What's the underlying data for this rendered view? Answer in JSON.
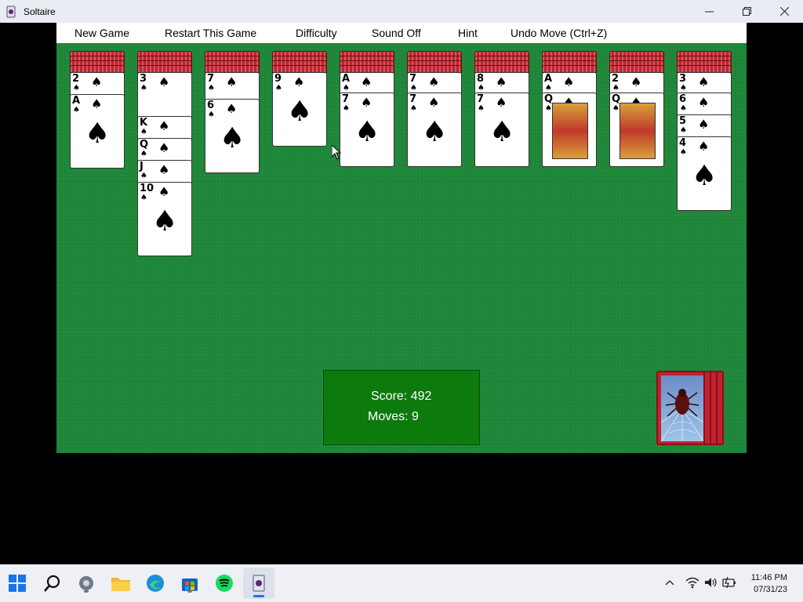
{
  "window": {
    "title": "Soltaire"
  },
  "menu": {
    "new_game": "New Game",
    "restart": "Restart This Game",
    "difficulty": "Difficulty",
    "sound": "Sound Off",
    "hint": "Hint",
    "undo": "Undo Move (Ctrl+Z)"
  },
  "tableau": [
    {
      "hidden": 4,
      "face_up": [
        "2",
        "A"
      ]
    },
    {
      "hidden": 4,
      "face_up": [
        "3",
        "K",
        "Q",
        "J",
        "10"
      ]
    },
    {
      "hidden": 4,
      "face_up": [
        "7",
        "6"
      ]
    },
    {
      "hidden": 4,
      "face_up": [
        "9"
      ]
    },
    {
      "hidden": 4,
      "face_up": [
        "A",
        "7"
      ]
    },
    {
      "hidden": 4,
      "face_up": [
        "7",
        "7"
      ]
    },
    {
      "hidden": 4,
      "face_up": [
        "8",
        "7"
      ]
    },
    {
      "hidden": 4,
      "face_up": [
        "A",
        "Q"
      ]
    },
    {
      "hidden": 4,
      "face_up": [
        "2",
        "Q"
      ]
    },
    {
      "hidden": 4,
      "face_up": [
        "3",
        "6",
        "5",
        "4"
      ]
    }
  ],
  "score": {
    "score_text": "Score: 492",
    "moves_text": "Moves: 9"
  },
  "stock_piles": 4,
  "taskbar": {
    "time": "11:46 PM",
    "date": "07/31/23",
    "apps": [
      "start-icon",
      "search-icon",
      "settings-icon",
      "file-explorer-icon",
      "edge-icon",
      "store-icon",
      "spotify-icon",
      "solitaire-icon"
    ]
  },
  "colors": {
    "felt": "#1f8a3a",
    "card_back": "#c1222e",
    "score_box": "#0d7a0d"
  }
}
